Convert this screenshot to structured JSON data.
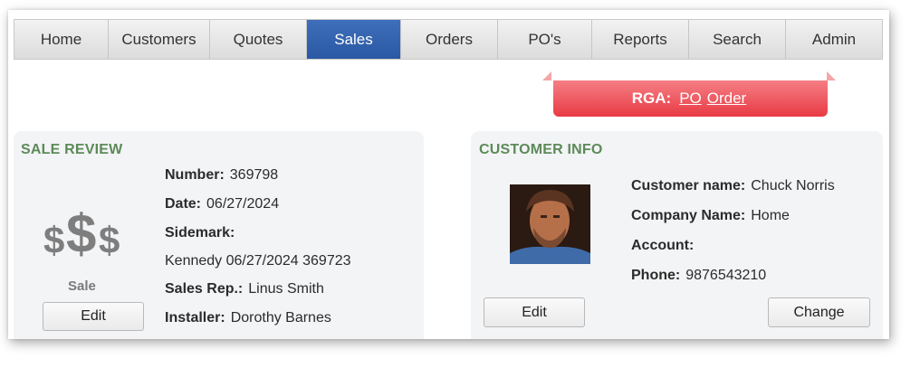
{
  "nav": {
    "items": [
      {
        "label": "Home",
        "width": 104
      },
      {
        "label": "Customers",
        "width": 112
      },
      {
        "label": "Quotes",
        "width": 107
      },
      {
        "label": "Sales",
        "width": 104,
        "active": true
      },
      {
        "label": "Orders",
        "width": 107
      },
      {
        "label": "PO's",
        "width": 104
      },
      {
        "label": "Reports",
        "width": 107
      },
      {
        "label": "Search",
        "width": 107
      },
      {
        "label": "Admin",
        "width": 106
      }
    ]
  },
  "rga": {
    "label": "RGA:",
    "links": [
      "PO",
      "Order"
    ]
  },
  "sale_review": {
    "title": "SALE REVIEW",
    "icon_text": [
      "$",
      "$",
      "$"
    ],
    "type_label": "Sale",
    "edit_label": "Edit",
    "number_label": "Number:",
    "number": "369798",
    "date_label": "Date:",
    "date": "06/27/2024",
    "sidemark_label": "Sidemark:",
    "sidemark": "Kennedy 06/27/2024 369723",
    "sales_rep_label": "Sales Rep.:",
    "sales_rep": "Linus Smith",
    "installer_label": "Installer:",
    "installer": "Dorothy Barnes"
  },
  "customer_info": {
    "title": "CUSTOMER INFO",
    "customer_name_label": "Customer name:",
    "customer_name": "Chuck Norris",
    "company_label": "Company Name:",
    "company": "Home",
    "account_label": "Account:",
    "account": "",
    "phone_label": "Phone:",
    "phone": "9876543210",
    "edit_label": "Edit",
    "change_label": "Change"
  },
  "colors": {
    "accent": "#2a58a3",
    "rga": "#e83a44",
    "section_title": "#5c8a58"
  }
}
